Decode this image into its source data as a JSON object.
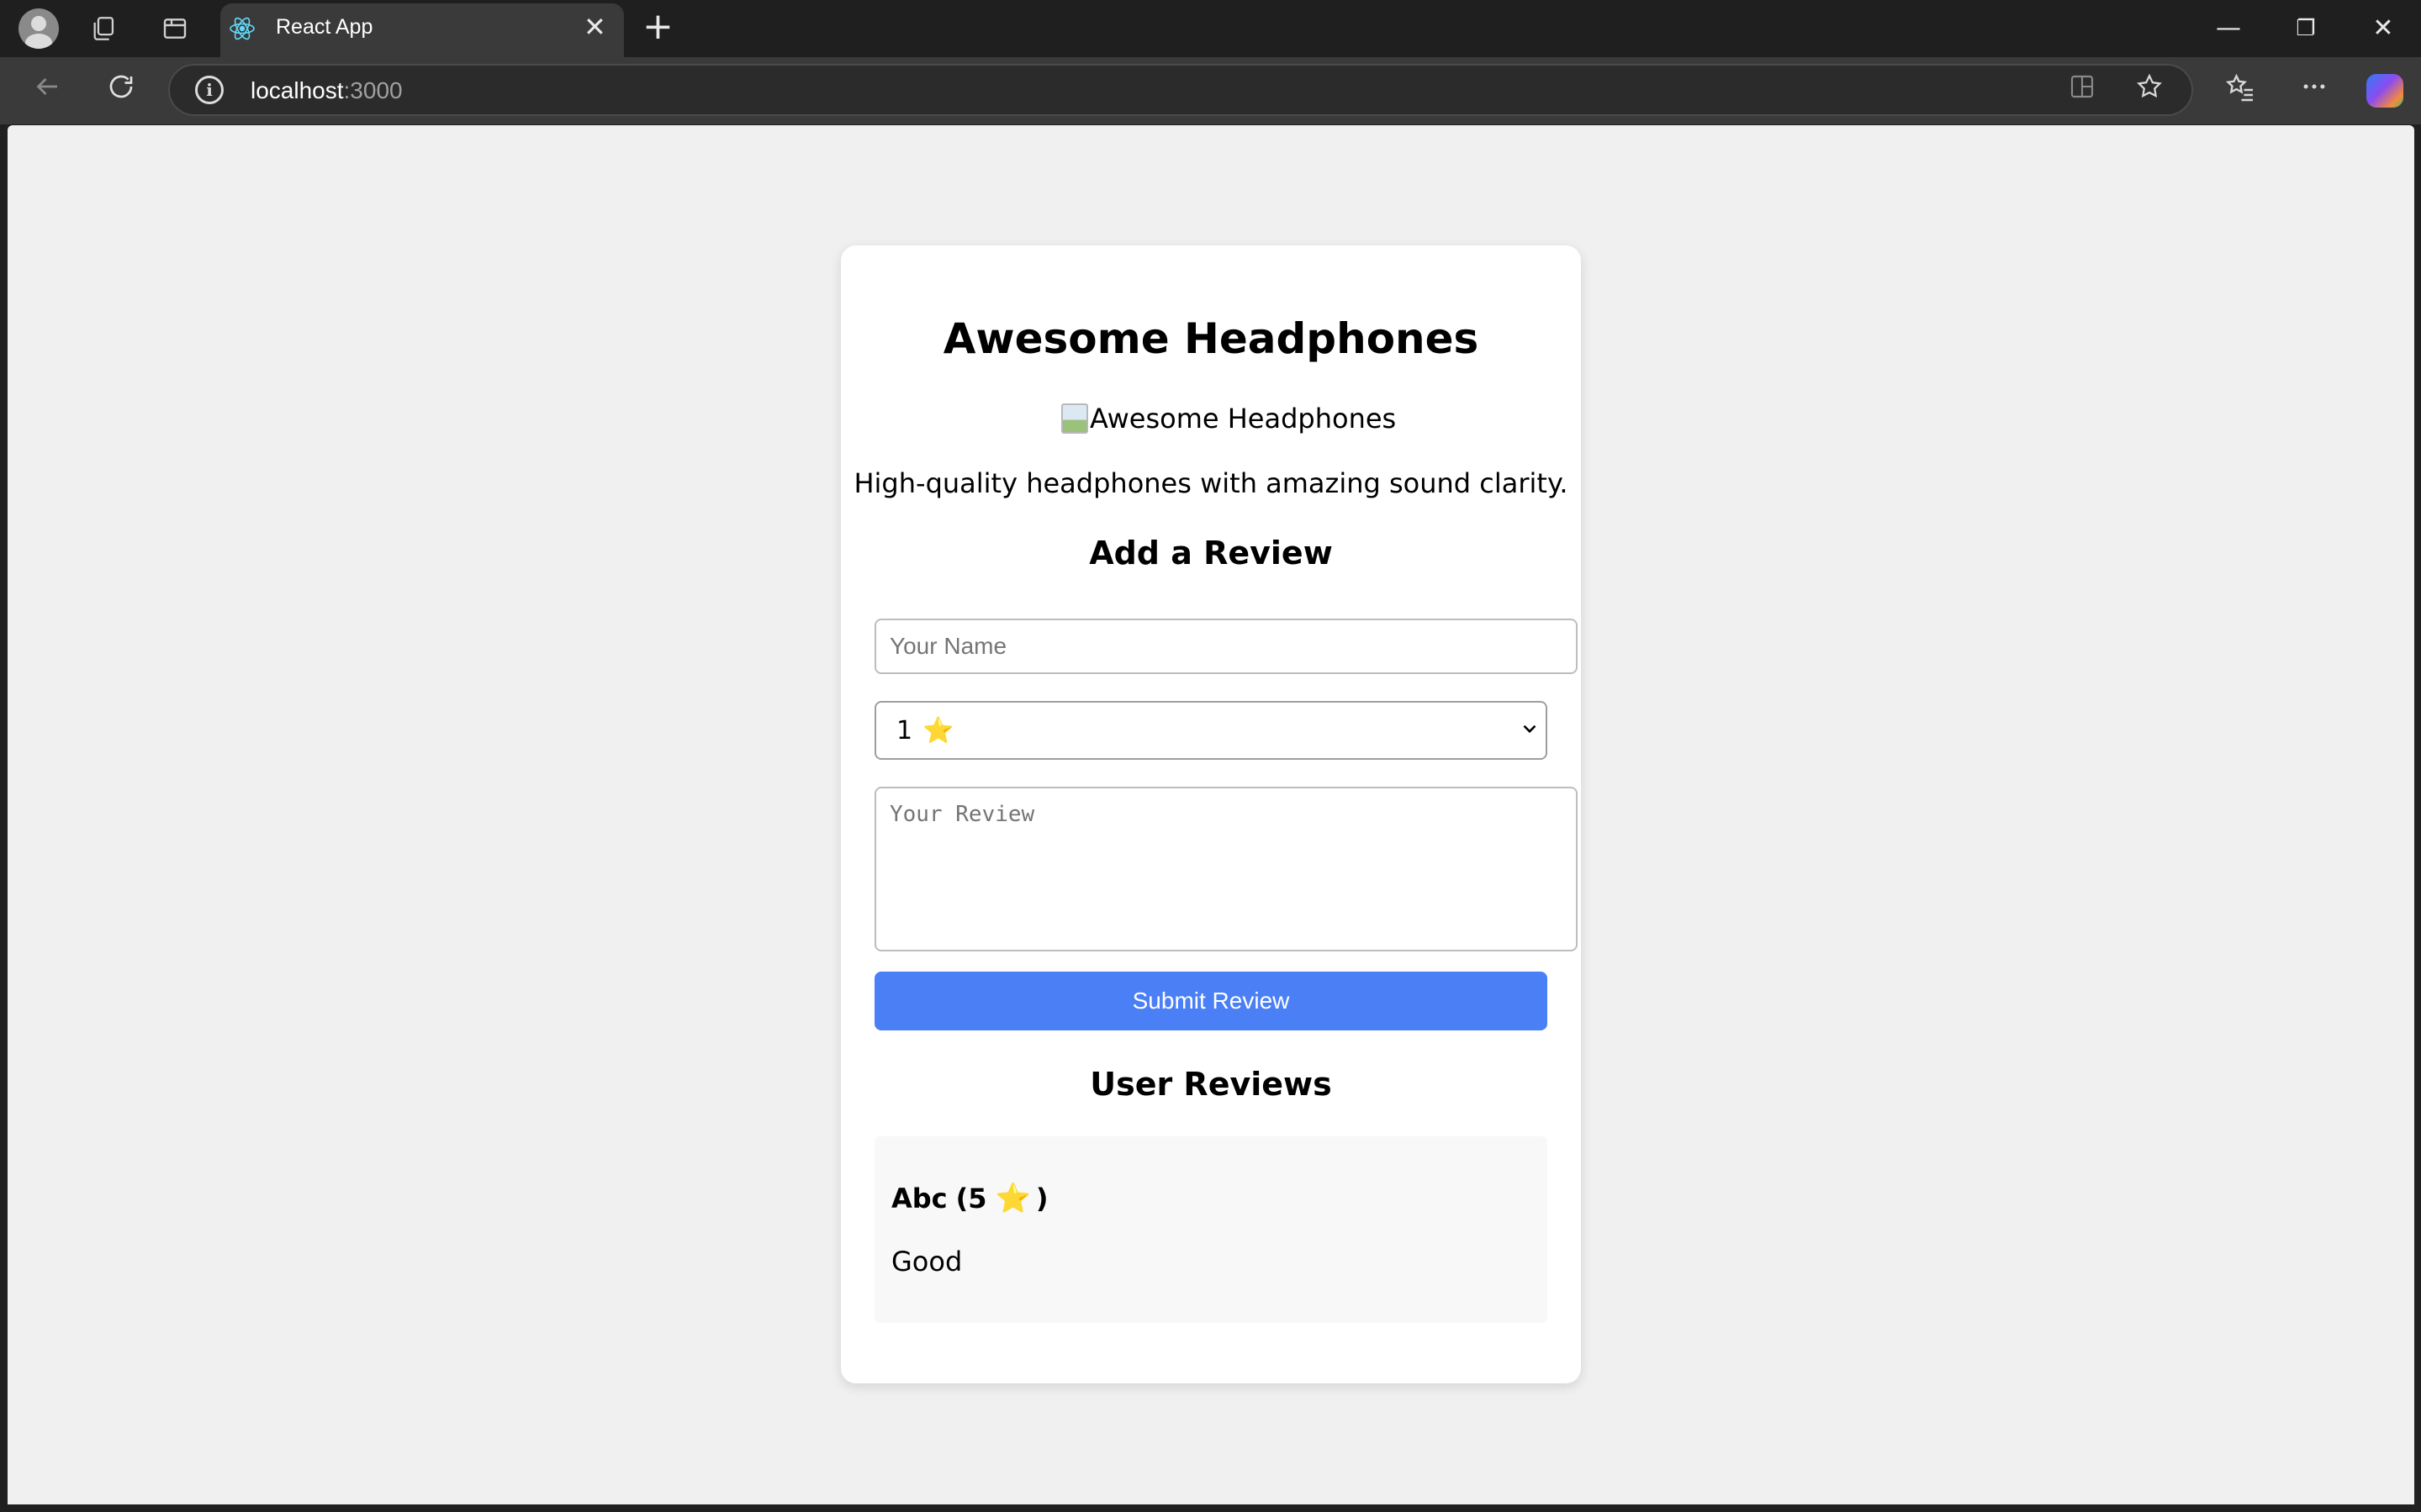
{
  "browser": {
    "tab_title": "React App",
    "tab_close": "✕",
    "new_tab": "+",
    "url_host": "localhost",
    "url_port": ":3000",
    "window_controls": {
      "minimize": "—",
      "restore": "❐",
      "close": "✕"
    }
  },
  "product": {
    "title": "Awesome Headphones",
    "image_alt": "Awesome Headphones",
    "description": "High-quality headphones with amazing sound clarity."
  },
  "form": {
    "heading": "Add a Review",
    "name_placeholder": "Your Name",
    "name_value": "",
    "rating_value": "1",
    "rating_star": "⭐",
    "review_placeholder": "Your Review",
    "submit_label": "Submit Review"
  },
  "reviews": {
    "heading": "User Reviews",
    "items": [
      {
        "name": "Abc",
        "rating_open": "(5",
        "star": "⭐",
        "rating_close": ")",
        "text": "Good"
      }
    ]
  },
  "colors": {
    "accent": "#4a7ff5",
    "star": "#f5c518",
    "page_bg": "#f0f0f0"
  }
}
